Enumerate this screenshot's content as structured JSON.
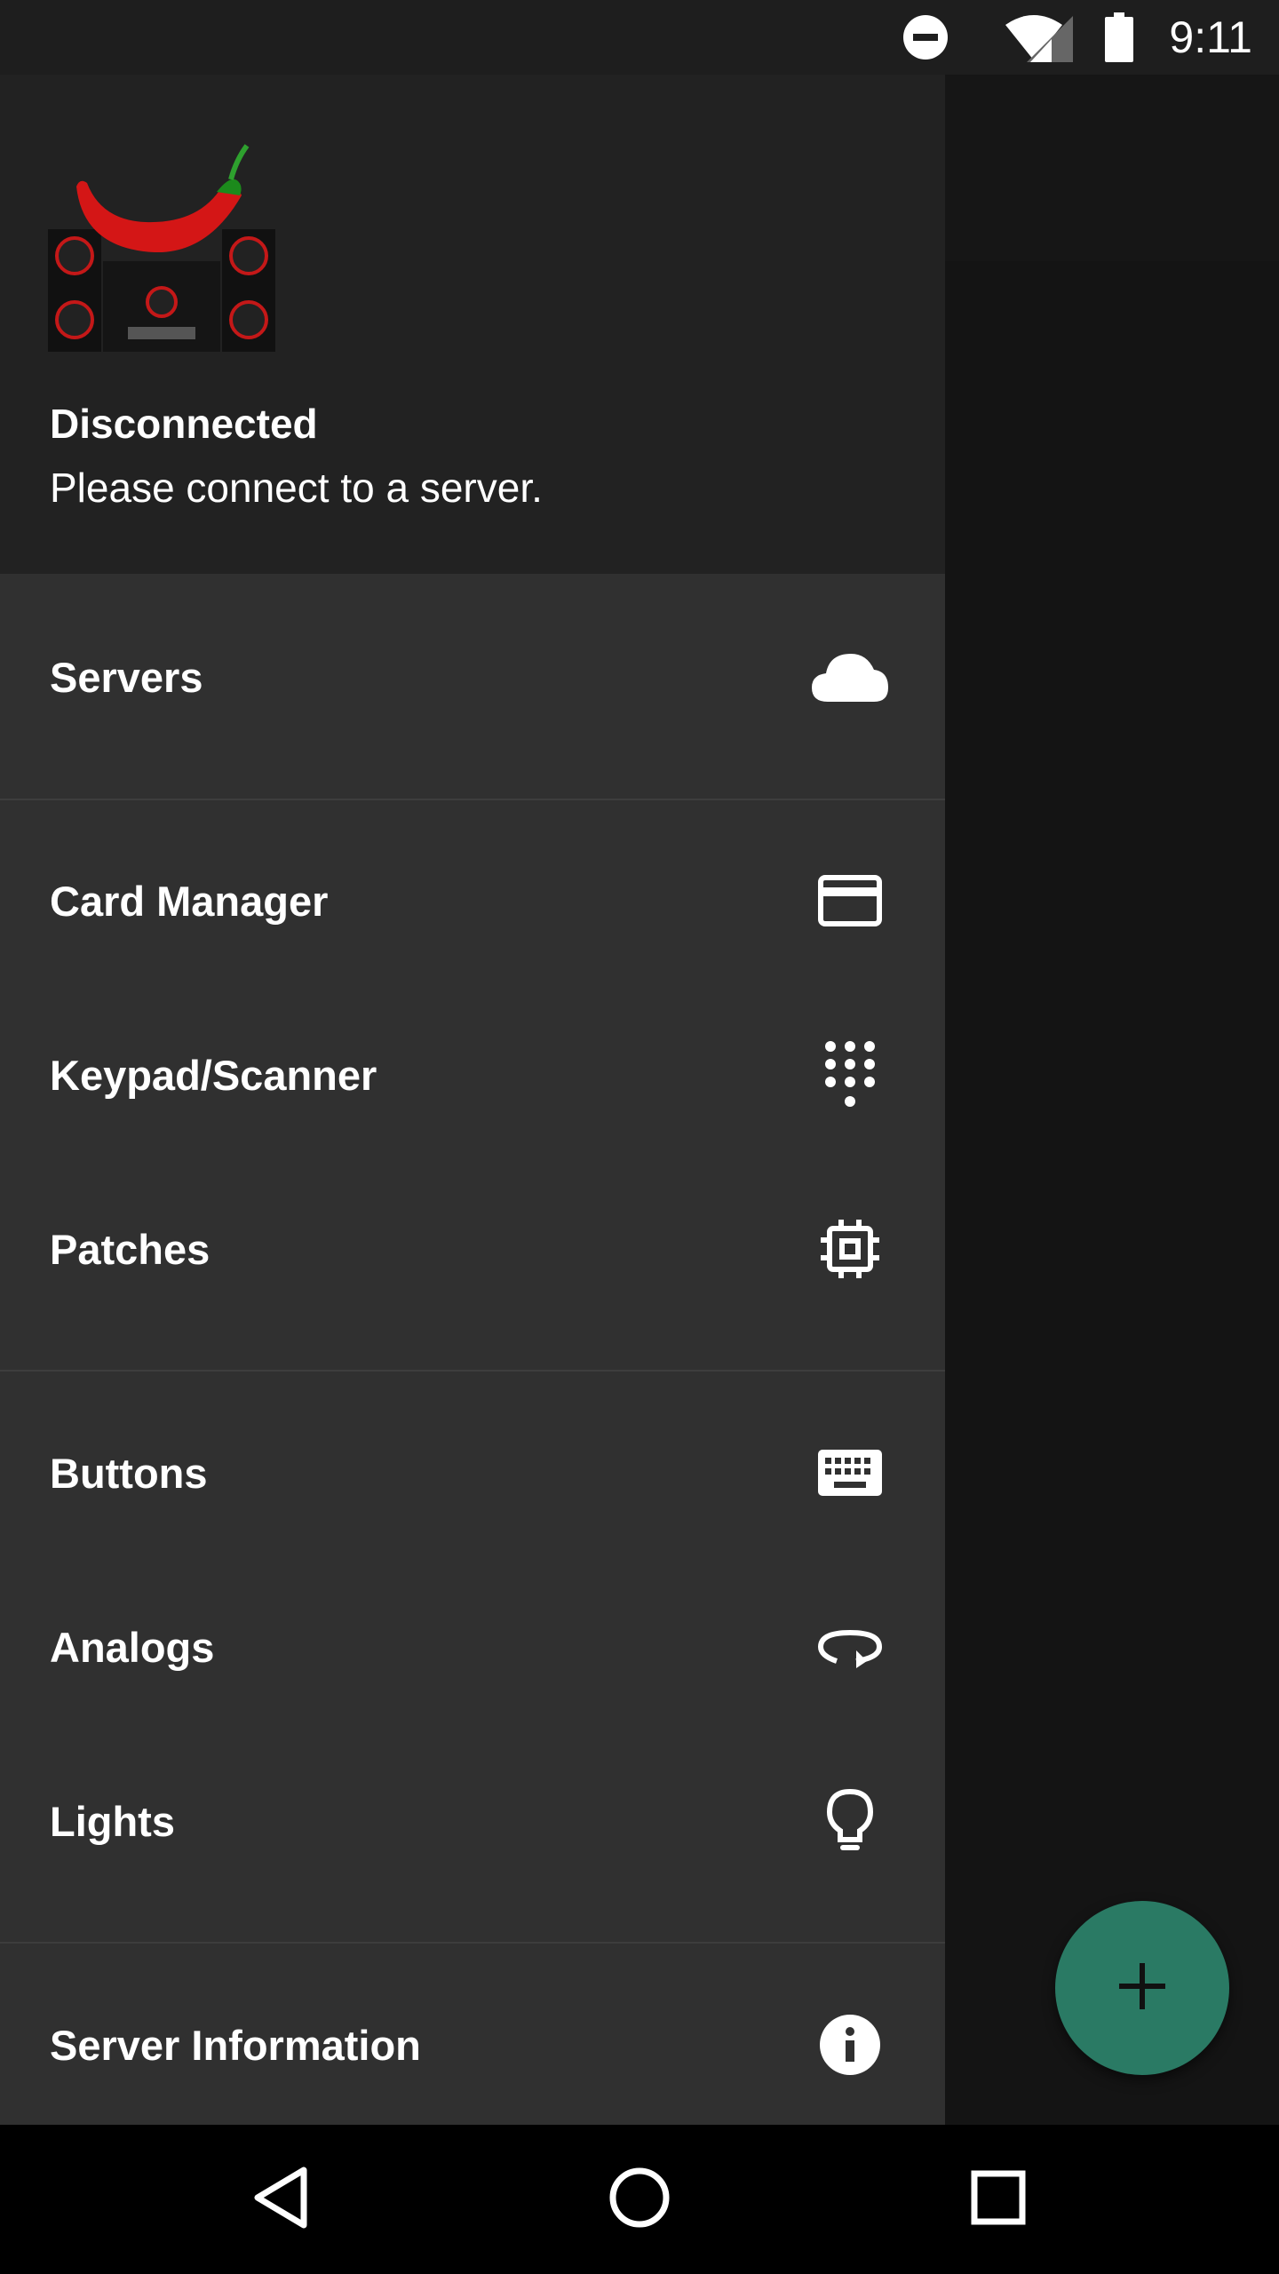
{
  "status_bar": {
    "time": "9:11",
    "icons": [
      "do-not-disturb-icon",
      "wifi-icon",
      "cell-signal-icon",
      "battery-icon"
    ]
  },
  "drawer": {
    "header": {
      "logo_icon": "chili-speaker-logo",
      "title": "Disconnected",
      "subtitle": "Please connect to a server."
    },
    "items": [
      {
        "label": "Servers",
        "icon": "cloud-icon"
      },
      {
        "label": "Card Manager",
        "icon": "card-icon"
      },
      {
        "label": "Keypad/Scanner",
        "icon": "dialpad-icon"
      },
      {
        "label": "Patches",
        "icon": "chip-icon"
      },
      {
        "label": "Buttons",
        "icon": "keyboard-icon"
      },
      {
        "label": "Analogs",
        "icon": "rotate-icon"
      },
      {
        "label": "Lights",
        "icon": "lightbulb-icon"
      },
      {
        "label": "Server Information",
        "icon": "info-icon"
      }
    ]
  },
  "fab": {
    "icon": "plus-icon",
    "color": "#2a7a64"
  },
  "nav_bar": {
    "icons": [
      "back-icon",
      "home-icon",
      "recents-icon"
    ]
  }
}
